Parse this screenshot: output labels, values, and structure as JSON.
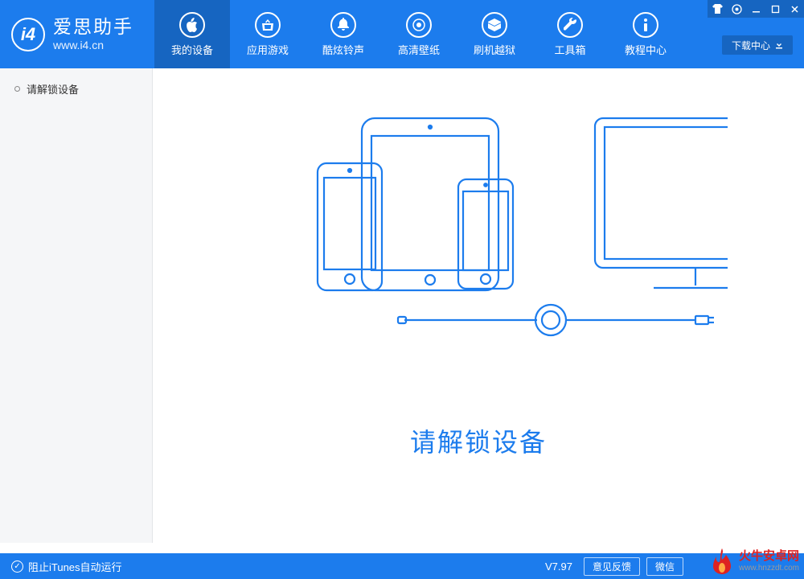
{
  "brand": {
    "title": "爱思助手",
    "url": "www.i4.cn"
  },
  "nav": {
    "items": [
      {
        "label": "我的设备",
        "icon": "apple-icon"
      },
      {
        "label": "应用游戏",
        "icon": "store-icon"
      },
      {
        "label": "酷炫铃声",
        "icon": "bell-icon"
      },
      {
        "label": "高清壁纸",
        "icon": "wallpaper-icon"
      },
      {
        "label": "刷机越狱",
        "icon": "box-icon"
      },
      {
        "label": "工具箱",
        "icon": "wrench-icon"
      },
      {
        "label": "教程中心",
        "icon": "info-icon"
      }
    ],
    "active_index": 0
  },
  "download_button": "下载中心",
  "sidebar": {
    "items": [
      {
        "label": "请解锁设备"
      }
    ]
  },
  "main": {
    "unlock_text": "请解锁设备"
  },
  "footer": {
    "left_text": "阻止iTunes自动运行",
    "version": "V7.97",
    "feedback_btn": "意见反馈",
    "wechat_btn": "微信"
  },
  "watermark": {
    "title": "火牛安卓网",
    "url": "www.hnzzdt.com"
  }
}
